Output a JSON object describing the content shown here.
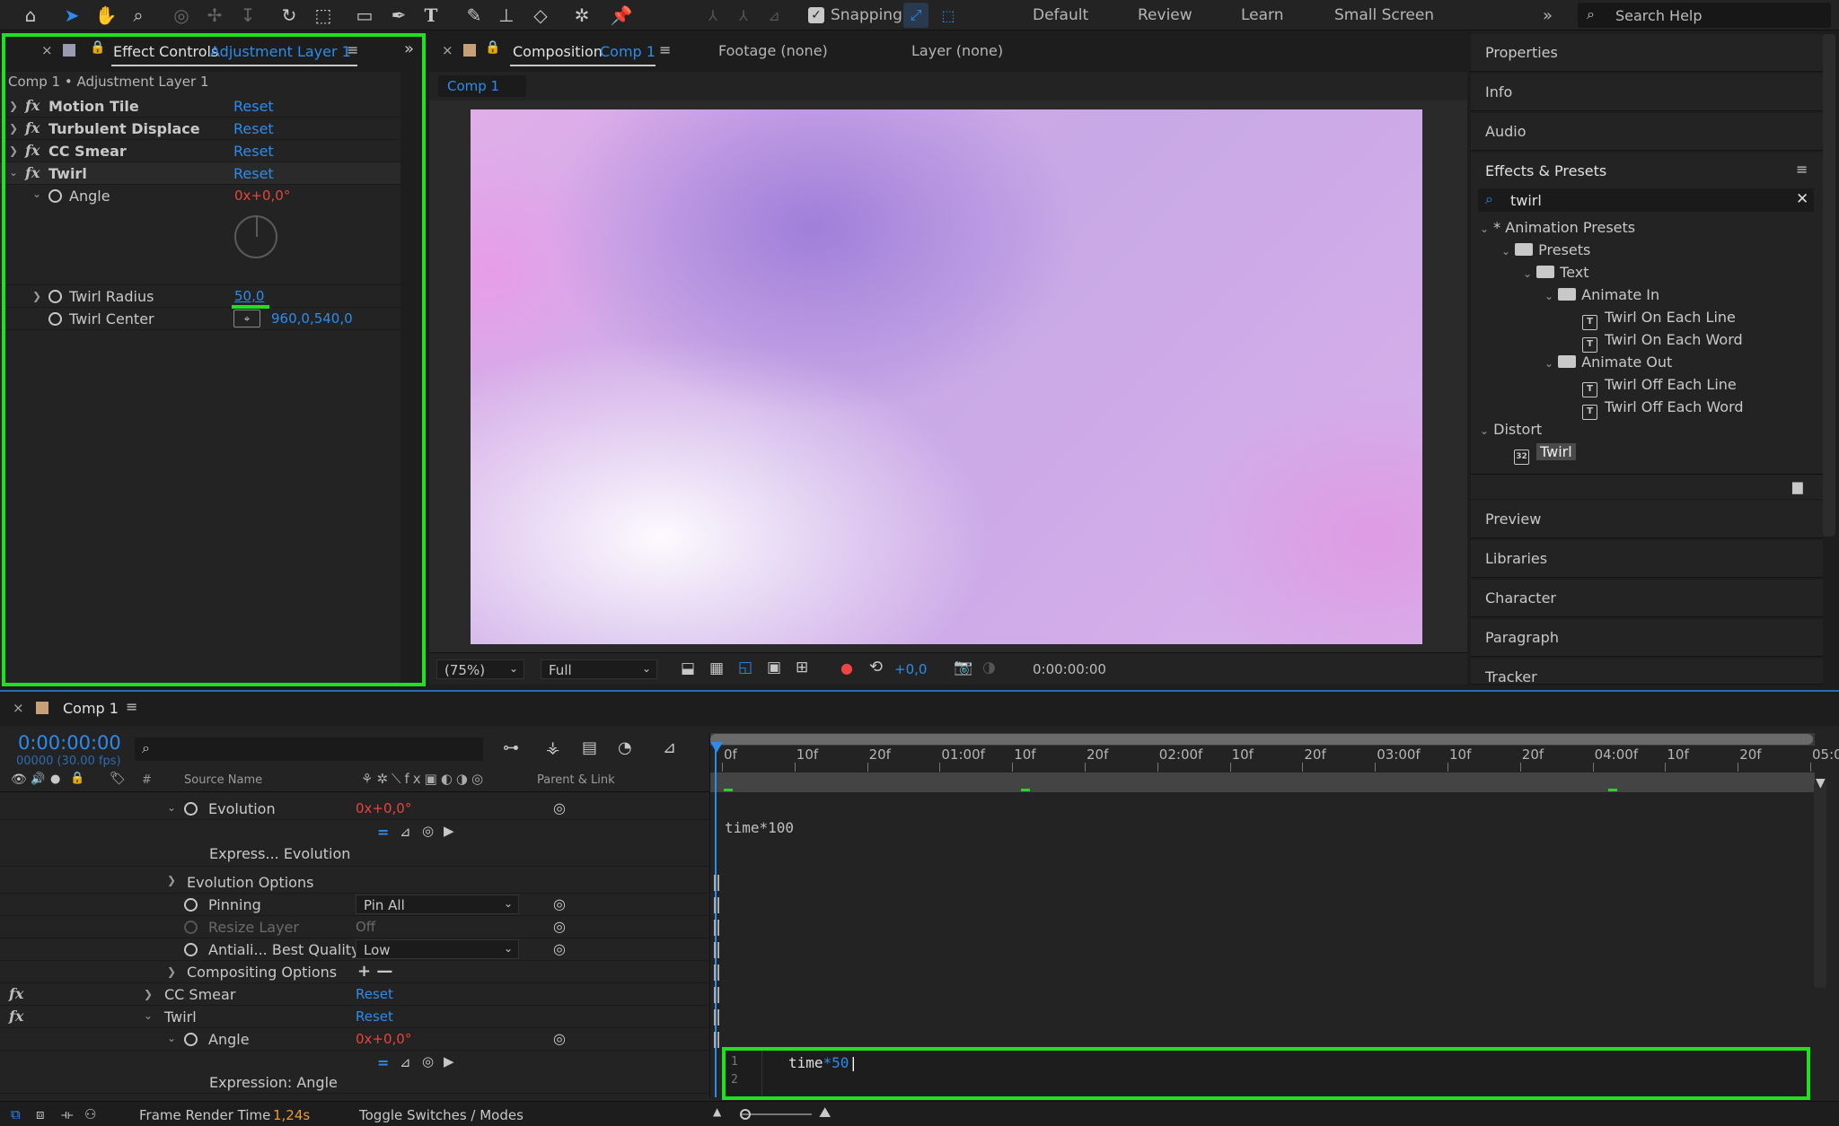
{
  "toolbar": {
    "snapping_label": "Snapping",
    "workspaces": [
      "Default",
      "Review",
      "Learn",
      "Small Screen"
    ],
    "search_placeholder": "Search Help"
  },
  "effect_controls": {
    "tab_label": "Effect Controls",
    "tab_layer": "Adjustment Layer 1",
    "breadcrumb": "Comp 1 • Adjustment Layer 1",
    "reset": "Reset",
    "effects": [
      "Motion Tile",
      "Turbulent Displace",
      "CC Smear",
      "Twirl"
    ],
    "angle_label": "Angle",
    "angle_revs": "0x",
    "angle_deg": "+0,0°",
    "radius_label": "Twirl Radius",
    "radius_value": "50,0",
    "center_label": "Twirl Center",
    "center_value": "960,0,540,0"
  },
  "composition": {
    "tab_label": "Composition",
    "tab_comp": "Comp 1",
    "footage_tab": "Footage (none)",
    "layer_tab": "Layer (none)",
    "subtab": "Comp 1",
    "zoom": "(75%)",
    "resolution": "Full",
    "exposure": "+0,0",
    "timecode": "0:00:00:00"
  },
  "right_panel": {
    "top_items": [
      "Properties",
      "Info",
      "Audio"
    ],
    "effects_presets_title": "Effects & Presets",
    "search_value": "twirl",
    "tree": {
      "animation_presets": "* Animation Presets",
      "presets": "Presets",
      "text": "Text",
      "animate_in": "Animate In",
      "in_items": [
        "Twirl On Each Line",
        "Twirl On Each Word"
      ],
      "animate_out": "Animate Out",
      "out_items": [
        "Twirl Off Each Line",
        "Twirl Off Each Word"
      ],
      "distort": "Distort",
      "twirl": "Twirl"
    },
    "bottom_items": [
      "Preview",
      "Libraries",
      "Character",
      "Paragraph",
      "Tracker"
    ]
  },
  "timeline": {
    "tab_label": "Comp 1",
    "timecode": "0:00:00:00",
    "fps": "00000 (30.00 fps)",
    "col_hash": "#",
    "col_source": "Source Name",
    "col_parent": "Parent & Link",
    "ruler": [
      "0f",
      "10f",
      "20f",
      "01:00f",
      "10f",
      "20f",
      "02:00f",
      "10f",
      "20f",
      "03:00f",
      "10f",
      "20f",
      "04:00f",
      "10f",
      "20f",
      "05:0"
    ],
    "evolution_label": "Evolution",
    "evolution_revs": "0x",
    "evolution_deg": "+0,0°",
    "expr_evolution": "Express... Evolution",
    "evolution_options": "Evolution Options",
    "pinning_label": "Pinning",
    "pinning_value": "Pin All",
    "resize_label": "Resize Layer",
    "resize_value": "Off",
    "antialias_label": "Antiali... Best Quality",
    "antialias_value": "Low",
    "compositing_label": "Compositing Options",
    "compositing_value": "+ —",
    "cc_smear": "CC Smear",
    "twirl": "Twirl",
    "reset": "Reset",
    "angle_label": "Angle",
    "angle_revs": "0x",
    "angle_deg": "+0,0°",
    "expr_angle": "Expression: Angle",
    "expr1_code": "time*100",
    "expr2_line1_no": "1",
    "expr2_line2_no": "2",
    "expr2_code_a": "time",
    "expr2_code_b": "*50",
    "frame_render_label": "Frame Render Time",
    "frame_render_value": "1,24s",
    "toggle_label": "Toggle Switches / Modes"
  }
}
